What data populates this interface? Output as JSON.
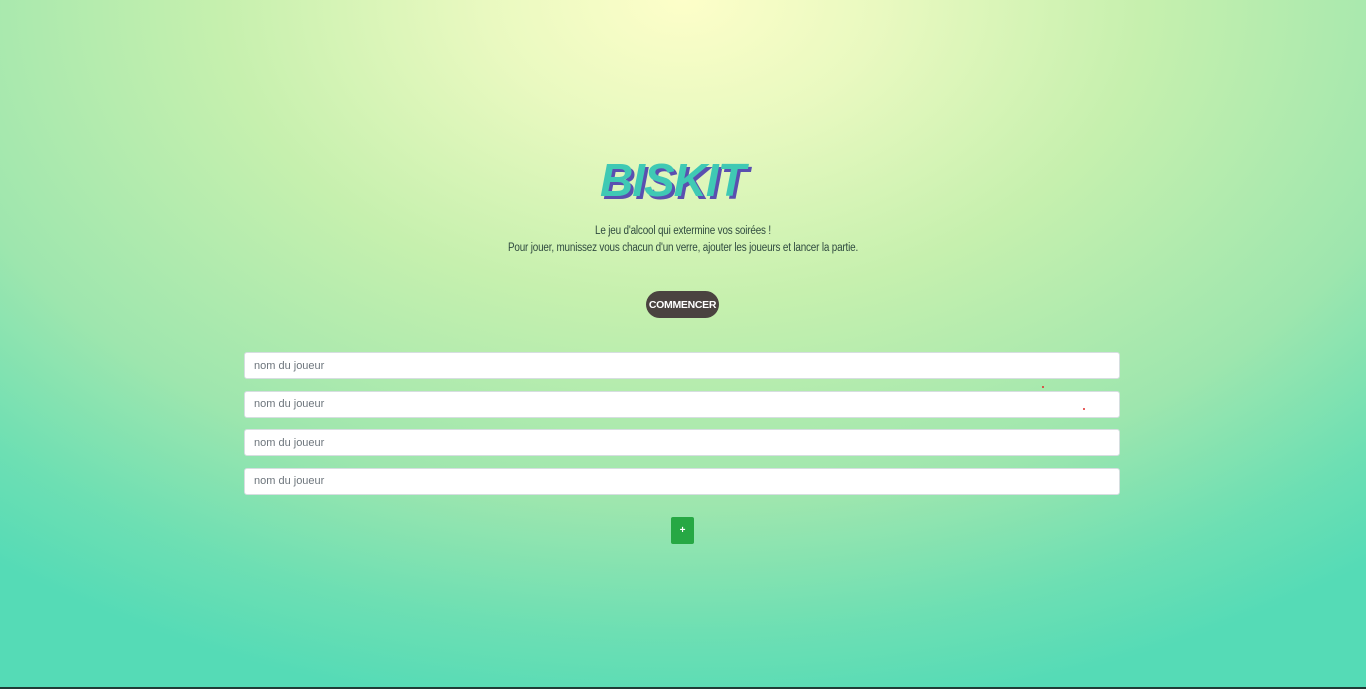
{
  "app": {
    "logo_text": "BISKIT",
    "logo_colors": {
      "fill": "#3fc9b4",
      "shadow": "#5a4fb0"
    }
  },
  "intro": {
    "line1": "Le jeu d'alcool qui extermine vos soirées !",
    "line2": "Pour jouer, munissez vous chacun d'un verre, ajouter les joueurs et lancer la partie."
  },
  "actions": {
    "start_label": "COMMENCER",
    "add_label": "+"
  },
  "players": [
    {
      "placeholder": "nom du joueur",
      "value": ""
    },
    {
      "placeholder": "nom du joueur",
      "value": ""
    },
    {
      "placeholder": "nom du joueur",
      "value": ""
    },
    {
      "placeholder": "nom du joueur",
      "value": ""
    }
  ],
  "colors": {
    "start_button": "#4a4340",
    "add_button": "#27a844"
  }
}
